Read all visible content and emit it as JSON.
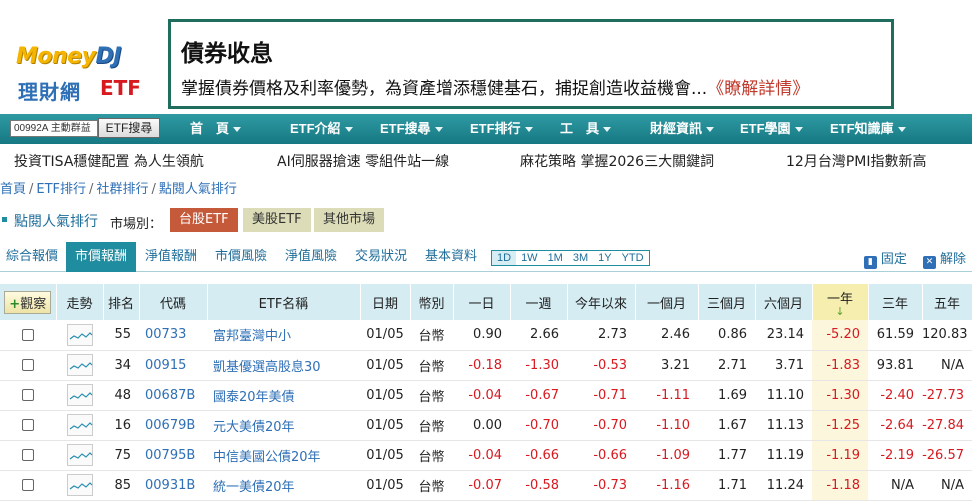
{
  "header": {
    "logo_money": "Money",
    "logo_dj": "DJ",
    "logo_cn": "理財網",
    "logo_etf": "ETF",
    "banner_title": "債券收息",
    "banner_text": "掌握債券價格及利率優勢，為資產增添穩健基石，捕捉創造收益機會...",
    "banner_link": "《瞭解詳情》"
  },
  "search": {
    "value": "00992A 主動群益",
    "button": "ETF搜尋"
  },
  "nav": [
    "首　頁",
    "ETF介紹",
    "ETF搜尋",
    "ETF排行",
    "工　具",
    "財經資訊",
    "ETF學園",
    "ETF知識庫"
  ],
  "ticker": [
    "投資TISA穩健配置 為人生領航",
    "AI伺服器搶速 零組件站一線",
    "麻花策略 掌握2026三大關鍵詞",
    "12月台灣PMI指數新高"
  ],
  "breadcrumb": [
    "首頁",
    "ETF排行",
    "社群排行",
    "點閱人氣排行"
  ],
  "page": {
    "title": "點閱人氣排行",
    "market_label": "市場別：",
    "markets": [
      "台股ETF",
      "美股ETF",
      "其他市場"
    ]
  },
  "subtabs": [
    "綜合報價",
    "市價報酬",
    "淨值報酬",
    "市價風險",
    "淨值風險",
    "交易狀況",
    "基本資料"
  ],
  "periods": [
    "1D",
    "1W",
    "1M",
    "3M",
    "1Y",
    "YTD"
  ],
  "tools": {
    "pin": "固定",
    "release": "解除"
  },
  "table": {
    "watch_button": "觀察",
    "headers": [
      "",
      "走勢",
      "排名",
      "代碼",
      "ETF名稱",
      "日期",
      "幣別",
      "一日",
      "一週",
      "今年以來",
      "一個月",
      "三個月",
      "六個月",
      "一年",
      "三年",
      "五年"
    ],
    "rows": [
      {
        "rank": "55",
        "code": "00733",
        "name": "富邦臺灣中小",
        "date": "01/05",
        "cur": "台幣",
        "d1": "0.90",
        "w1": "2.66",
        "ytd": "2.73",
        "m1": "2.46",
        "m3": "0.86",
        "m6": "23.14",
        "y1": "-5.20",
        "y3": "61.59",
        "y5": "120.83"
      },
      {
        "rank": "34",
        "code": "00915",
        "name": "凱基優選高股息30",
        "date": "01/05",
        "cur": "台幣",
        "d1": "-0.18",
        "w1": "-1.30",
        "ytd": "-0.53",
        "m1": "3.21",
        "m3": "2.71",
        "m6": "3.71",
        "y1": "-1.83",
        "y3": "93.81",
        "y5": "N/A"
      },
      {
        "rank": "48",
        "code": "00687B",
        "name": "國泰20年美債",
        "date": "01/05",
        "cur": "台幣",
        "d1": "-0.04",
        "w1": "-0.67",
        "ytd": "-0.71",
        "m1": "-1.11",
        "m3": "1.69",
        "m6": "11.10",
        "y1": "-1.30",
        "y3": "-2.40",
        "y5": "-27.73"
      },
      {
        "rank": "16",
        "code": "00679B",
        "name": "元大美債20年",
        "date": "01/05",
        "cur": "台幣",
        "d1": "0.00",
        "w1": "-0.70",
        "ytd": "-0.70",
        "m1": "-1.10",
        "m3": "1.67",
        "m6": "11.13",
        "y1": "-1.25",
        "y3": "-2.64",
        "y5": "-27.84"
      },
      {
        "rank": "75",
        "code": "00795B",
        "name": "中信美國公債20年",
        "date": "01/05",
        "cur": "台幣",
        "d1": "-0.04",
        "w1": "-0.66",
        "ytd": "-0.66",
        "m1": "-1.09",
        "m3": "1.77",
        "m6": "11.19",
        "y1": "-1.19",
        "y3": "-2.19",
        "y5": "-26.57"
      },
      {
        "rank": "85",
        "code": "00931B",
        "name": "統一美債20年",
        "date": "01/05",
        "cur": "台幣",
        "d1": "-0.07",
        "w1": "-0.58",
        "ytd": "-0.73",
        "m1": "-1.16",
        "m3": "1.71",
        "m6": "11.24",
        "y1": "-1.18",
        "y3": "N/A",
        "y5": "N/A"
      }
    ]
  },
  "colors": {
    "nav_bg": "#1f8ca0",
    "negative": "#d71920",
    "link": "#2e6fb6",
    "active_market": "#c55a3a",
    "highlight_col": "#f6eeae"
  }
}
